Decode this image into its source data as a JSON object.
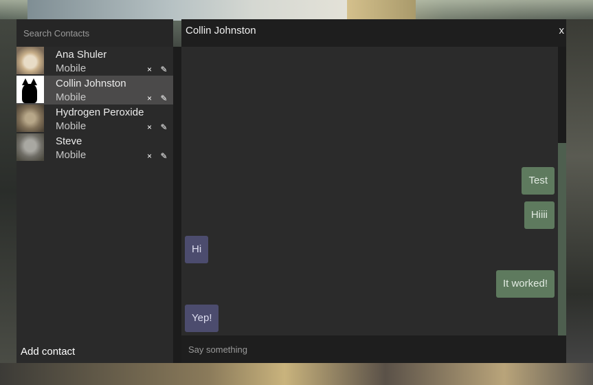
{
  "search": {
    "placeholder": "Search Contacts"
  },
  "contacts": [
    {
      "name": "Ana Shuler",
      "type": "Mobile",
      "avatar": "cat-face-avatar",
      "selected": false
    },
    {
      "name": "Collin Johnston",
      "type": "Mobile",
      "avatar": "black-cat-silhouette-avatar",
      "selected": true
    },
    {
      "name": "Hydrogen Peroxide",
      "type": "Mobile",
      "avatar": "tabby-cat-avatar",
      "selected": false
    },
    {
      "name": "Steve",
      "type": "Mobile",
      "avatar": "ostrich-avatar",
      "selected": false
    }
  ],
  "contact_actions": {
    "delete": "×",
    "edit": "✎"
  },
  "sidebar": {
    "add_contact": "Add contact"
  },
  "chat": {
    "title": "Collin Johnston",
    "close": "x",
    "messages": [
      {
        "text": "Test",
        "direction": "out"
      },
      {
        "text": "Hiiii",
        "direction": "out"
      },
      {
        "text": "Hi",
        "direction": "in"
      },
      {
        "text": "It worked!",
        "direction": "out"
      },
      {
        "text": "Yep!",
        "direction": "in"
      }
    ],
    "composer_placeholder": "Say something"
  },
  "colors": {
    "outgoing_bubble": "#5e7a5e",
    "incoming_bubble": "#4c4c6e",
    "selected_contact": "#4b4a4a"
  }
}
